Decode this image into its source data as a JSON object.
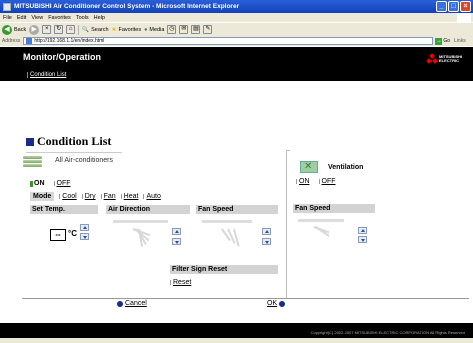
{
  "window": {
    "title": "MITSUBISHI Air Conditioner Control System - Microsoft Internet Explorer"
  },
  "menu": [
    "File",
    "Edit",
    "View",
    "Favorites",
    "Tools",
    "Help"
  ],
  "toolbar": {
    "back": "Back",
    "search": "Search",
    "favorites": "Favorites",
    "media": "Media"
  },
  "address": {
    "label": "Address",
    "url": "http://192.168.1.1/en/index.html",
    "go": "Go",
    "links": "Links"
  },
  "header": {
    "title": "Monitor/Operation",
    "breadcrumb": "Condition List",
    "brand": "MITSUBISHI ELECTRIC"
  },
  "page": {
    "title": "Condition List",
    "group_label": "All Air-conditioners"
  },
  "ac": {
    "on_label": "ON",
    "off_label": "OFF",
    "mode_label": "Mode",
    "modes": [
      "Cool",
      "Dry",
      "Fan",
      "Heat",
      "Auto"
    ],
    "set_temp_label": "Set Temp.",
    "temp_value": "--",
    "temp_unit": "°C",
    "air_direction_label": "Air Direction",
    "fan_speed_label": "Fan Speed",
    "filter_label": "Filter Sign Reset",
    "reset_label": "Reset"
  },
  "ventilation": {
    "label": "Ventilation",
    "on_label": "ON",
    "off_label": "OFF",
    "fan_speed_label": "Fan Speed"
  },
  "actions": {
    "cancel": "Cancel",
    "ok": "OK"
  },
  "footer": {
    "copyright": "Copyright(C) 2002-2007 MITSUBISHI ELECTRIC CORPORATION All Rights Reserved"
  },
  "colors": {
    "header_bg": "#000000",
    "title_block": "#1a2c8a",
    "on_indicator": "#3a9a2e",
    "brand_red": "#e00000"
  }
}
